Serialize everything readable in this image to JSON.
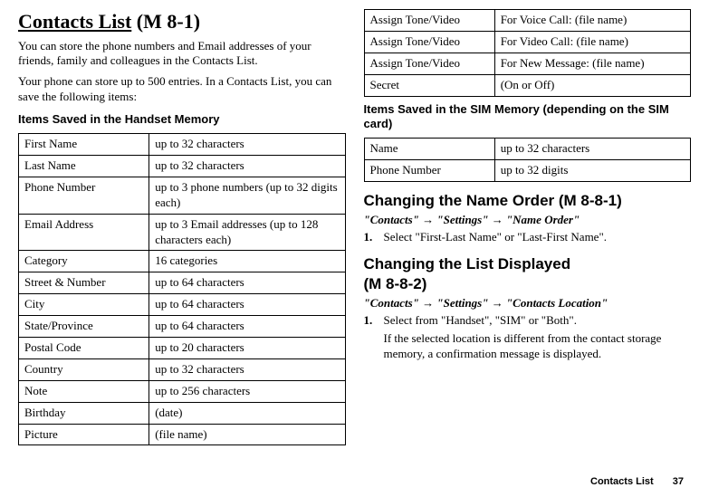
{
  "left": {
    "title_underline": "Contacts List",
    "title_code": "(M 8-1)",
    "intro1": "You can store the phone numbers and Email addresses of your friends, family and colleagues in the Contacts List.",
    "intro2": "Your phone can store up to 500 entries. In a Contacts List, you can save the following items:",
    "heading": "Items Saved in the Handset Memory",
    "table": [
      [
        "First Name",
        "up to 32 characters"
      ],
      [
        "Last Name",
        "up to 32 characters"
      ],
      [
        "Phone Number",
        "up to 3 phone numbers (up to 32 digits each)"
      ],
      [
        "Email Address",
        "up to 3 Email addresses (up to 128 characters each)"
      ],
      [
        "Category",
        "16 categories"
      ],
      [
        "Street & Number",
        "up to 64 characters"
      ],
      [
        "City",
        "up to 64 characters"
      ],
      [
        "State/Province",
        "up to 64 characters"
      ],
      [
        "Postal Code",
        "up to 20 characters"
      ],
      [
        "Country",
        "up to 32 characters"
      ],
      [
        "Note",
        "up to 256 characters"
      ],
      [
        "Birthday",
        "(date)"
      ],
      [
        "Picture",
        "(file name)"
      ]
    ]
  },
  "right": {
    "table_top": [
      [
        "Assign Tone/Video",
        "For Voice Call: (file name)"
      ],
      [
        "Assign Tone/Video",
        "For Video Call: (file name)"
      ],
      [
        "Assign Tone/Video",
        "For New Message: (file name)"
      ],
      [
        "Secret",
        "(On or Off)"
      ]
    ],
    "heading_sim": "Items Saved in the SIM Memory (depending on the SIM card)",
    "table_sim": [
      [
        "Name",
        "up to 32 characters"
      ],
      [
        "Phone Number",
        "up to 32 digits"
      ]
    ],
    "sec1": {
      "title": "Changing the Name Order",
      "code": "(M 8-8-1)",
      "path_prefix": "\"Contacts\" ",
      "path_mid": " \"Settings\" ",
      "path_suffix": " \"Name Order\"",
      "step_num": "1.",
      "step_txt": "Select \"First-Last Name\" or \"Last-First Name\"."
    },
    "sec2": {
      "title": "Changing the List Displayed",
      "code": "(M 8-8-2)",
      "path_prefix": "\"Contacts\" ",
      "path_mid": " \"Settings\" ",
      "path_suffix": " \"Contacts Location\"",
      "step_num": "1.",
      "step_txt": "Select from \"Handset\", \"SIM\" or \"Both\".",
      "step_sub": "If the selected location is different from the contact storage memory, a confirmation message is displayed."
    }
  },
  "footer": {
    "label": "Contacts List",
    "page": "37"
  },
  "arrow": "→"
}
